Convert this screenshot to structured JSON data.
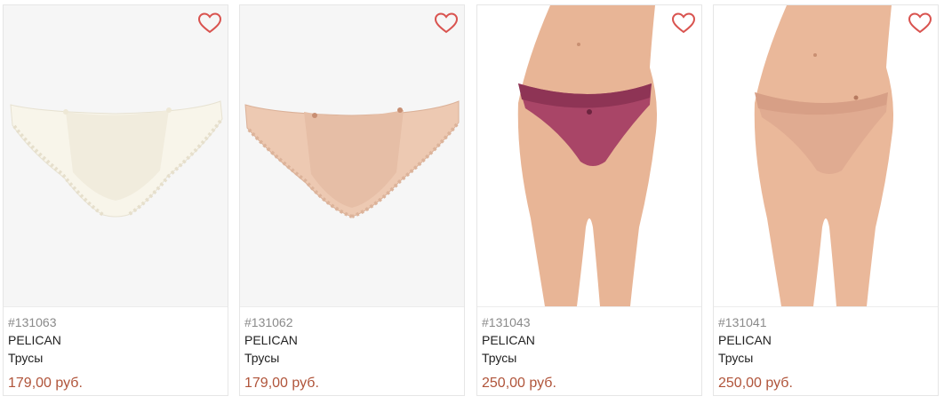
{
  "colors": {
    "accent": "#d9534f",
    "price": "#b0543a",
    "sku": "#8a8a8a",
    "text": "#222222",
    "border": "#e6e6e6"
  },
  "products": [
    {
      "sku": "#131063",
      "brand": "PELICAN",
      "type": "Трусы",
      "price": "179,00 руб.",
      "photo": "ivory-lace-briefs",
      "favorite_icon": "heart-outline-icon"
    },
    {
      "sku": "#131062",
      "brand": "PELICAN",
      "type": "Трусы",
      "price": "179,00 руб.",
      "photo": "beige-lace-briefs",
      "favorite_icon": "heart-outline-icon"
    },
    {
      "sku": "#131043",
      "brand": "PELICAN",
      "type": "Трусы",
      "price": "250,00 руб.",
      "photo": "model-berry-briefs",
      "favorite_icon": "heart-outline-icon"
    },
    {
      "sku": "#131041",
      "brand": "PELICAN",
      "type": "Трусы",
      "price": "250,00 руб.",
      "photo": "model-beige-briefs",
      "favorite_icon": "heart-outline-icon"
    }
  ]
}
